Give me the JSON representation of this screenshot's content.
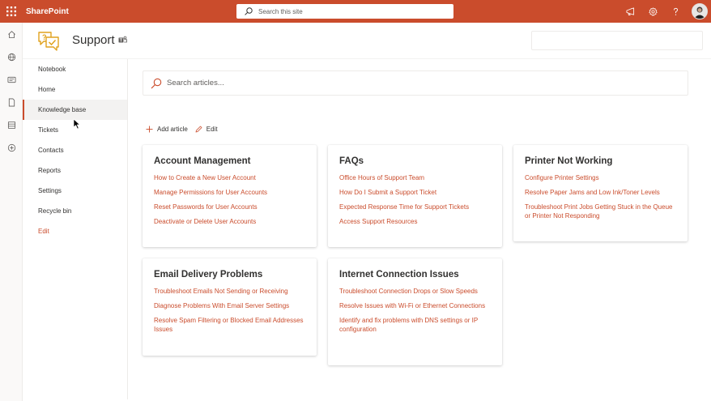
{
  "topbar": {
    "brand": "SharePoint",
    "search_placeholder": "Search this site",
    "accent": "#ca4c2c"
  },
  "site": {
    "title": "Support"
  },
  "nav": {
    "items": [
      {
        "label": "Notebook"
      },
      {
        "label": "Home"
      },
      {
        "label": "Knowledge base",
        "selected": true
      },
      {
        "label": "Tickets"
      },
      {
        "label": "Contacts"
      },
      {
        "label": "Reports"
      },
      {
        "label": "Settings"
      },
      {
        "label": "Recycle bin"
      }
    ],
    "edit_label": "Edit"
  },
  "main": {
    "search_placeholder": "Search articles...",
    "commands": {
      "add_article": "Add article",
      "edit": "Edit"
    },
    "cards": [
      {
        "title": "Account Management",
        "links": [
          "How to Create a New User Account",
          "Manage Permissions for User Accounts",
          "Reset Passwords for User Accounts",
          "Deactivate or Delete User Accounts"
        ]
      },
      {
        "title": "FAQs",
        "links": [
          "Office Hours of Support Team",
          "How Do I Submit a Support Ticket",
          "Expected Response Time for Support Tickets",
          "Access Support Resources"
        ]
      },
      {
        "title": "Printer Not Working",
        "links": [
          "Configure Printer Settings",
          "Resolve Paper Jams and Low Ink/Toner Levels",
          "Troubleshoot Print Jobs Getting Stuck in the Queue or Printer Not Responding"
        ]
      },
      {
        "title": "Email Delivery Problems",
        "links": [
          "Troubleshoot Emails Not Sending or Receiving",
          "Diagnose Problems With Email Server Settings",
          "Resolve Spam Filtering or Blocked Email Addresses Issues"
        ]
      },
      {
        "title": "Internet Connection Issues",
        "links": [
          "Troubleshoot Connection Drops or Slow Speeds",
          "Resolve Issues with Wi-Fi or Ethernet Connections",
          "Identify and fix problems with DNS settings or IP configuration"
        ]
      }
    ]
  },
  "icons": {
    "app_launcher": "waffle-icon",
    "search": "search-icon",
    "megaphone": "megaphone-icon",
    "settings": "gear-icon",
    "help": "help-icon",
    "rail": [
      "home-icon",
      "globe-icon",
      "news-icon",
      "document-icon",
      "list-icon",
      "add-icon"
    ],
    "site_logo": "support-logo-icon",
    "teams": "teams-icon",
    "add": "plus-icon",
    "edit": "pencil-icon"
  }
}
